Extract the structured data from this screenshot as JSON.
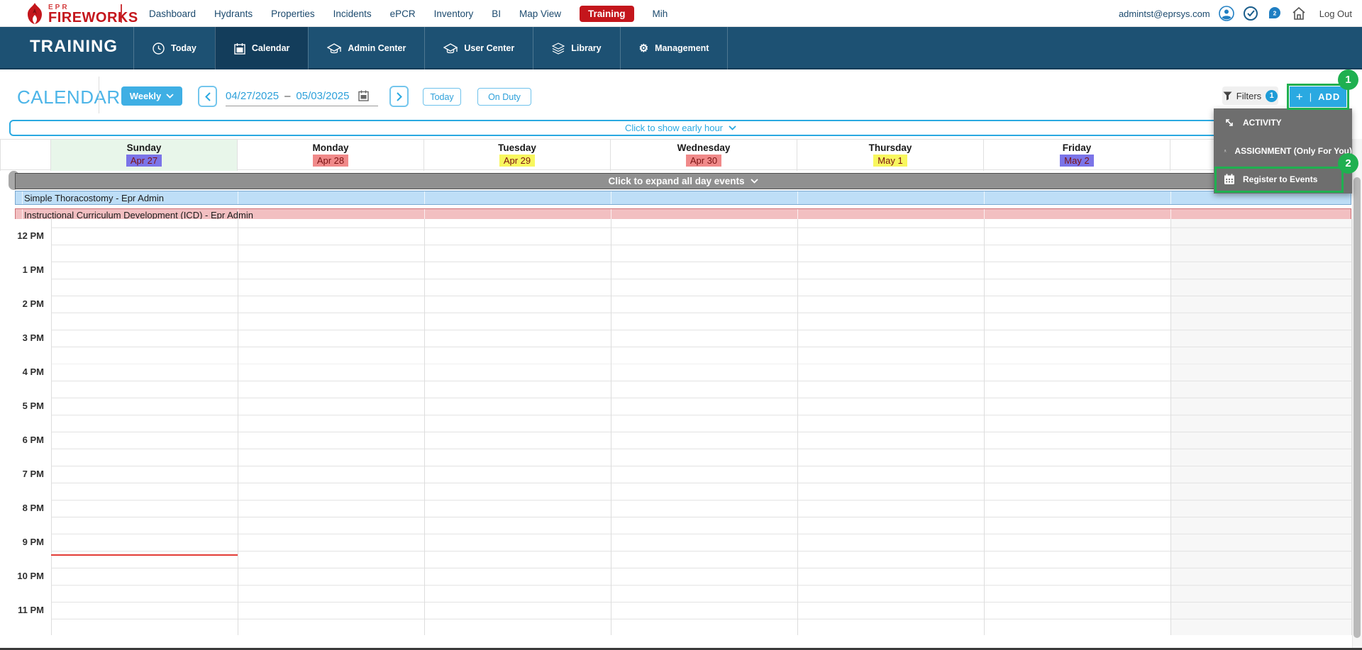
{
  "top_nav": {
    "logo": {
      "epr": "EPR",
      "fireworks": "FIREWORKS"
    },
    "items": [
      {
        "label": "Dashboard"
      },
      {
        "label": "Hydrants"
      },
      {
        "label": "Properties"
      },
      {
        "label": "Incidents"
      },
      {
        "label": "ePCR"
      },
      {
        "label": "Inventory"
      },
      {
        "label": "BI"
      },
      {
        "label": "Map View"
      },
      {
        "label": "Training",
        "active": true
      },
      {
        "label": "Mih"
      }
    ],
    "user_email": "admintst@eprsys.com",
    "chat_badge_count": "2",
    "log_out_label": "Log Out",
    "active_item_color": "#c4161c"
  },
  "module_nav": {
    "title": "TRAINING",
    "bar_color": "#1d5173",
    "items": [
      {
        "label": "Today",
        "icon": "clock-icon"
      },
      {
        "label": "Calendar",
        "icon": "calendar-icon",
        "active": true
      },
      {
        "label": "Admin Center",
        "icon": "graduation-cap-icon"
      },
      {
        "label": "User Center",
        "icon": "graduation-cap-icon"
      },
      {
        "label": "Library",
        "icon": "layers-icon"
      },
      {
        "label": "Management",
        "icon": "gear-icon"
      }
    ]
  },
  "toolbar": {
    "page_title": "CALENDAR",
    "view_selector_value": "Weekly",
    "date_start": "04/27/2025",
    "date_separator": "–",
    "date_end": "05/03/2025",
    "today_label": "Today",
    "on_duty_label": "On Duty",
    "filters_label": "Filters",
    "filters_count": "1",
    "add_plus": "+",
    "add_divider": "|",
    "add_label": "ADD",
    "accent_color": "#2aa9e1"
  },
  "add_menu": {
    "items": [
      {
        "label": "ACTIVITY",
        "icon": "activity-arrows-icon"
      },
      {
        "label": "ASSIGNMENT (Only For You)",
        "icon": "person-icon"
      },
      {
        "label": "Register to Events",
        "icon": "calendar-grid-icon"
      }
    ]
  },
  "annotations": {
    "step1": "1",
    "step2": "2",
    "highlight_color": "#1fb050"
  },
  "calendar": {
    "early_hour_label": "Click to show early hour",
    "expand_all_day_label": "Click to expand all day events",
    "days": [
      {
        "name": "Sunday",
        "date": "Apr 27",
        "chip_color": "#7b74e8",
        "today": true
      },
      {
        "name": "Monday",
        "date": "Apr 28",
        "chip_color": "#f08a8a"
      },
      {
        "name": "Tuesday",
        "date": "Apr 29",
        "chip_color": "#f8f75e"
      },
      {
        "name": "Wednesday",
        "date": "Apr 30",
        "chip_color": "#f08a8a"
      },
      {
        "name": "Thursday",
        "date": "May 1",
        "chip_color": "#f8f75e"
      },
      {
        "name": "Friday",
        "date": "May 2",
        "chip_color": "#7b74e8"
      }
    ],
    "all_day_events": [
      {
        "title": "Simple Thoracostomy - Epr Admin",
        "bg": "#bedef7",
        "border": "#79a7cf"
      },
      {
        "title": "Instructional Curriculum Development (ICD) - Epr Admin",
        "bg": "#f2bfc1",
        "border": "#cd7076"
      }
    ],
    "hours": [
      "12 PM",
      "1 PM",
      "2 PM",
      "3 PM",
      "4 PM",
      "5 PM",
      "6 PM",
      "7 PM",
      "8 PM",
      "9 PM",
      "10 PM",
      "11 PM"
    ],
    "now_line_color": "#e23c36"
  }
}
